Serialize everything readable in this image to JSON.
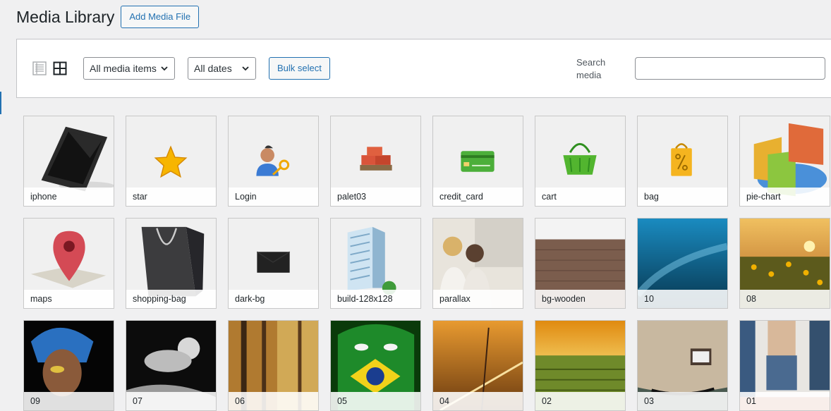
{
  "page": {
    "title": "Media Library",
    "add_button": "Add Media File"
  },
  "toolbar": {
    "filter_type": "All media items",
    "filter_date": "All dates",
    "bulk_select": "Bulk select",
    "search_label": "Search media",
    "search_value": ""
  },
  "media": [
    {
      "name": "iphone"
    },
    {
      "name": "star"
    },
    {
      "name": "Login"
    },
    {
      "name": "palet03"
    },
    {
      "name": "credit_card"
    },
    {
      "name": "cart"
    },
    {
      "name": "bag"
    },
    {
      "name": "pie-chart"
    },
    {
      "name": "maps"
    },
    {
      "name": "shopping-bag"
    },
    {
      "name": "dark-bg"
    },
    {
      "name": "build-128x128"
    },
    {
      "name": "parallax"
    },
    {
      "name": "bg-wooden"
    },
    {
      "name": "10"
    },
    {
      "name": "08"
    },
    {
      "name": "09"
    },
    {
      "name": "07"
    },
    {
      "name": "06"
    },
    {
      "name": "05"
    },
    {
      "name": "04"
    },
    {
      "name": "02"
    },
    {
      "name": "03"
    },
    {
      "name": "01"
    }
  ]
}
